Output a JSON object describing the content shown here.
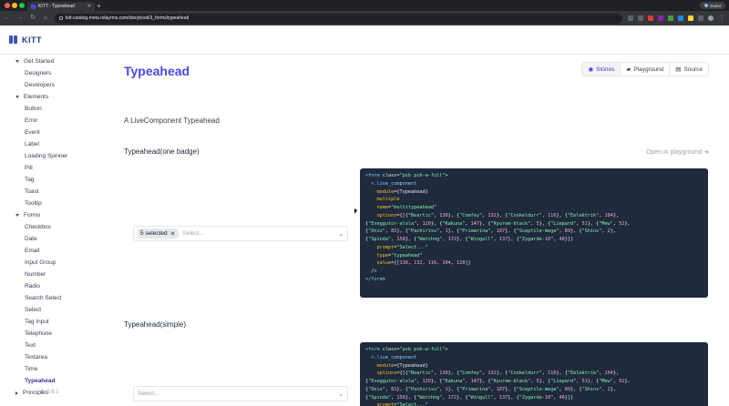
{
  "browser": {
    "tab_title": "KITT - Typeahead",
    "url": "kitt-catalog.meta.relayrms.com/storybook/3_forms/typeahead",
    "profile_label": "Guest",
    "colors": {
      "chrome_dark": "#202124",
      "chrome_bar": "#35363a"
    },
    "icons": [
      "back-icon",
      "forward-icon",
      "reload-icon",
      "home-icon",
      "lock-icon",
      "star-icon",
      "extensions-icon",
      "profile-icon"
    ]
  },
  "app": {
    "logo_text": "KITT",
    "brand_color": "#3f51b5"
  },
  "sidebar": {
    "groups": [
      {
        "label": "Get Started",
        "expanded": true,
        "items": [
          "Designers",
          "Developers"
        ]
      },
      {
        "label": "Elements",
        "expanded": true,
        "items": [
          "Button",
          "Error",
          "Event",
          "Label",
          "Loading Spinner",
          "Pill",
          "Tag",
          "Toast",
          "Tooltip"
        ]
      },
      {
        "label": "Forms",
        "expanded": true,
        "items": [
          "Checkbox",
          "Date",
          "Email",
          "Input Group",
          "Number",
          "Radio",
          "Search Select",
          "Select",
          "Tag Input",
          "Telephone",
          "Text",
          "Textarea",
          "Time",
          "Typeahead"
        ]
      },
      {
        "label": "Principles",
        "expanded": false,
        "items": []
      }
    ],
    "active_item": "Typeahead",
    "version": "0.6.1"
  },
  "main": {
    "title": "Typeahead",
    "subtitle": "A LiveComponent Typeahead",
    "switcher": [
      {
        "label": "Stories",
        "icon": "eye-icon",
        "active": true
      },
      {
        "label": "Playground",
        "icon": "gamepad-icon",
        "active": false
      },
      {
        "label": "Source",
        "icon": "file-icon",
        "active": false
      }
    ],
    "open_playground_label": "Open in playground",
    "stories": [
      {
        "title": "Typeahead(one badge)",
        "badge": "5 selected",
        "placeholder": "Select...",
        "code": "<form class=\"psb psb-w-full\">\n  <.live_component\n    module={Typeahead}\n    multiple\n    name=\"multitypeahead\"\n    options={[{\"Beartic\", 130}, {\"Comfey\", 132}, {\"Conkeldurr\", 116}, {\"Eelektrik\", 104},\n{\"Exeggutor-alola\", 120}, {\"Kakuna\", 147}, {\"Kyurem-black\", 5}, {\"Liepard\", 51}, {\"Mew\", 52},\n{\"Onix\", 81}, {\"Pachirisu\", 1}, {\"Primarina\", 107}, {\"Sceptile-mega\", 89}, {\"Shinx\", 2},\n{\"Spinda\", 158}, {\"Watchog\", 172}, {\"Wingull\", 137}, {\"Zygarde-10\", 48}]}\n    prompt=\"Select...\"\n    type=\"typeahead\"\n    value={[130, 132, 116, 104, 120]}\n  />\n</form>"
      },
      {
        "title": "Typeahead(simple)",
        "placeholder": "Select...",
        "code": "<form class=\"psb psb-w-full\">\n  <.live_component\n    module={Typeahead}\n    options={[{\"Beartic\", 130}, {\"Comfey\", 132}, {\"Conkeldurr\", 116}, {\"Eelektrik\", 104},\n{\"Exeggutor-alola\", 120}, {\"Kakuna\", 147}, {\"Kyurem-black\", 5}, {\"Liepard\", 51}, {\"Mew\", 52},\n{\"Onix\", 81}, {\"Pachirisu\", 1}, {\"Primarina\", 107}, {\"Sceptile-mega\", 89}, {\"Shinx\", 2},\n{\"Spinda\", 158}, {\"Watchog\", 172}, {\"Wingull\", 137}, {\"Zygarde-10\", 48}]}\n    prompt=\"Select...\"\n    type=\"typeahead\""
      }
    ],
    "colors": {
      "title": "#4f46e5",
      "code_bg": "#1f2a3c"
    }
  }
}
